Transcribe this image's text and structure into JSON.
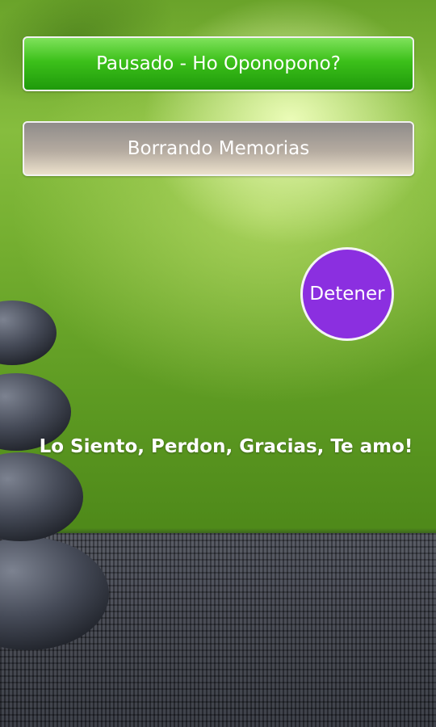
{
  "buttons": {
    "status_label": "Pausado - Ho Oponopono?",
    "mode_label": "Borrando Memorias",
    "stop_label": "Detener"
  },
  "mantra": {
    "text": "Lo Siento, Perdon, Gracias, Te amo!"
  },
  "colors": {
    "status_button": "#2fae12",
    "mode_button": "#b5aba0",
    "stop_button": "#8b2fe0",
    "background": "#6aa32a"
  }
}
